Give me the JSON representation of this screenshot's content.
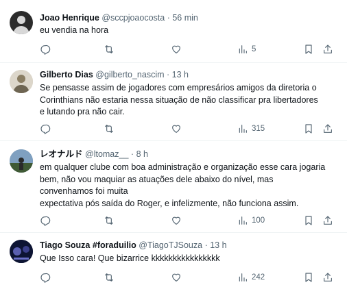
{
  "tweets": [
    {
      "name": "Joao Henrique",
      "handle": "@sccpjoaocosta",
      "time": "56 min",
      "lines": [
        "eu vendia na hora"
      ],
      "views": "5",
      "avatar": {
        "bg": "#2b2b2b",
        "fg": "#d8d8d8"
      }
    },
    {
      "name": "Gilberto Dias",
      "handle": "@gilberto_nascim",
      "time": "13 h",
      "lines": [
        "Se pensasse assim de jogadores com empresários amigos da diretoria o",
        "Corinthians não estaria nessa situação de não classificar pra libertadores",
        "e lutando pra não cair."
      ],
      "views": "315",
      "avatar": {
        "bg": "#c9c2b5",
        "fg": "#6e6552"
      }
    },
    {
      "name": "レオナルド",
      "handle": "@ltomaz__",
      "time": "8 h",
      "lines": [
        "em qualquer clube com boa administração e organização esse cara jogaria",
        "bem, não vou maquiar as atuações dele abaixo do nível, mas",
        "convenhamos foi muita",
        "expectativa pós saída do Roger, e infelizmente, não funciona assim."
      ],
      "views": "100",
      "avatar": {
        "bg": "#6a8aa8",
        "fg": "#2d3e2a"
      }
    },
    {
      "name": "Tiago Souza #foraduilio",
      "handle": "@TiagoTJSouza",
      "time": "13 h",
      "lines": [
        "Que Isso cara! Que bizarrice kkkkkkkkkkkkkkkk"
      ],
      "views": "242",
      "avatar": {
        "bg": "#0d1433",
        "fg": "#5a5fb0"
      }
    }
  ],
  "icons": {
    "reply": "reply-icon",
    "retweet": "retweet-icon",
    "like": "heart-icon",
    "views": "views-icon",
    "bookmark": "bookmark-icon",
    "share": "share-icon"
  },
  "separator": "·",
  "colors": {
    "text": "#0f1419",
    "secondary": "#536471",
    "divider": "#eff3f4"
  }
}
